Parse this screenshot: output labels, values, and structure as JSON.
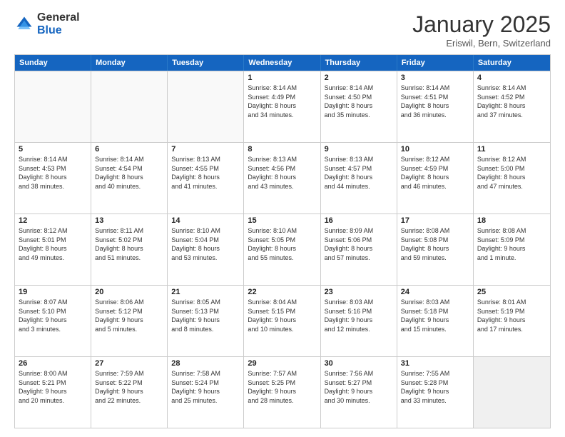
{
  "header": {
    "logo_general": "General",
    "logo_blue": "Blue",
    "month_title": "January 2025",
    "location": "Eriswil, Bern, Switzerland"
  },
  "weekdays": [
    "Sunday",
    "Monday",
    "Tuesday",
    "Wednesday",
    "Thursday",
    "Friday",
    "Saturday"
  ],
  "rows": [
    [
      {
        "day": "",
        "lines": []
      },
      {
        "day": "",
        "lines": []
      },
      {
        "day": "",
        "lines": []
      },
      {
        "day": "1",
        "lines": [
          "Sunrise: 8:14 AM",
          "Sunset: 4:49 PM",
          "Daylight: 8 hours",
          "and 34 minutes."
        ]
      },
      {
        "day": "2",
        "lines": [
          "Sunrise: 8:14 AM",
          "Sunset: 4:50 PM",
          "Daylight: 8 hours",
          "and 35 minutes."
        ]
      },
      {
        "day": "3",
        "lines": [
          "Sunrise: 8:14 AM",
          "Sunset: 4:51 PM",
          "Daylight: 8 hours",
          "and 36 minutes."
        ]
      },
      {
        "day": "4",
        "lines": [
          "Sunrise: 8:14 AM",
          "Sunset: 4:52 PM",
          "Daylight: 8 hours",
          "and 37 minutes."
        ]
      }
    ],
    [
      {
        "day": "5",
        "lines": [
          "Sunrise: 8:14 AM",
          "Sunset: 4:53 PM",
          "Daylight: 8 hours",
          "and 38 minutes."
        ]
      },
      {
        "day": "6",
        "lines": [
          "Sunrise: 8:14 AM",
          "Sunset: 4:54 PM",
          "Daylight: 8 hours",
          "and 40 minutes."
        ]
      },
      {
        "day": "7",
        "lines": [
          "Sunrise: 8:13 AM",
          "Sunset: 4:55 PM",
          "Daylight: 8 hours",
          "and 41 minutes."
        ]
      },
      {
        "day": "8",
        "lines": [
          "Sunrise: 8:13 AM",
          "Sunset: 4:56 PM",
          "Daylight: 8 hours",
          "and 43 minutes."
        ]
      },
      {
        "day": "9",
        "lines": [
          "Sunrise: 8:13 AM",
          "Sunset: 4:57 PM",
          "Daylight: 8 hours",
          "and 44 minutes."
        ]
      },
      {
        "day": "10",
        "lines": [
          "Sunrise: 8:12 AM",
          "Sunset: 4:59 PM",
          "Daylight: 8 hours",
          "and 46 minutes."
        ]
      },
      {
        "day": "11",
        "lines": [
          "Sunrise: 8:12 AM",
          "Sunset: 5:00 PM",
          "Daylight: 8 hours",
          "and 47 minutes."
        ]
      }
    ],
    [
      {
        "day": "12",
        "lines": [
          "Sunrise: 8:12 AM",
          "Sunset: 5:01 PM",
          "Daylight: 8 hours",
          "and 49 minutes."
        ]
      },
      {
        "day": "13",
        "lines": [
          "Sunrise: 8:11 AM",
          "Sunset: 5:02 PM",
          "Daylight: 8 hours",
          "and 51 minutes."
        ]
      },
      {
        "day": "14",
        "lines": [
          "Sunrise: 8:10 AM",
          "Sunset: 5:04 PM",
          "Daylight: 8 hours",
          "and 53 minutes."
        ]
      },
      {
        "day": "15",
        "lines": [
          "Sunrise: 8:10 AM",
          "Sunset: 5:05 PM",
          "Daylight: 8 hours",
          "and 55 minutes."
        ]
      },
      {
        "day": "16",
        "lines": [
          "Sunrise: 8:09 AM",
          "Sunset: 5:06 PM",
          "Daylight: 8 hours",
          "and 57 minutes."
        ]
      },
      {
        "day": "17",
        "lines": [
          "Sunrise: 8:08 AM",
          "Sunset: 5:08 PM",
          "Daylight: 8 hours",
          "and 59 minutes."
        ]
      },
      {
        "day": "18",
        "lines": [
          "Sunrise: 8:08 AM",
          "Sunset: 5:09 PM",
          "Daylight: 9 hours",
          "and 1 minute."
        ]
      }
    ],
    [
      {
        "day": "19",
        "lines": [
          "Sunrise: 8:07 AM",
          "Sunset: 5:10 PM",
          "Daylight: 9 hours",
          "and 3 minutes."
        ]
      },
      {
        "day": "20",
        "lines": [
          "Sunrise: 8:06 AM",
          "Sunset: 5:12 PM",
          "Daylight: 9 hours",
          "and 5 minutes."
        ]
      },
      {
        "day": "21",
        "lines": [
          "Sunrise: 8:05 AM",
          "Sunset: 5:13 PM",
          "Daylight: 9 hours",
          "and 8 minutes."
        ]
      },
      {
        "day": "22",
        "lines": [
          "Sunrise: 8:04 AM",
          "Sunset: 5:15 PM",
          "Daylight: 9 hours",
          "and 10 minutes."
        ]
      },
      {
        "day": "23",
        "lines": [
          "Sunrise: 8:03 AM",
          "Sunset: 5:16 PM",
          "Daylight: 9 hours",
          "and 12 minutes."
        ]
      },
      {
        "day": "24",
        "lines": [
          "Sunrise: 8:03 AM",
          "Sunset: 5:18 PM",
          "Daylight: 9 hours",
          "and 15 minutes."
        ]
      },
      {
        "day": "25",
        "lines": [
          "Sunrise: 8:01 AM",
          "Sunset: 5:19 PM",
          "Daylight: 9 hours",
          "and 17 minutes."
        ]
      }
    ],
    [
      {
        "day": "26",
        "lines": [
          "Sunrise: 8:00 AM",
          "Sunset: 5:21 PM",
          "Daylight: 9 hours",
          "and 20 minutes."
        ]
      },
      {
        "day": "27",
        "lines": [
          "Sunrise: 7:59 AM",
          "Sunset: 5:22 PM",
          "Daylight: 9 hours",
          "and 22 minutes."
        ]
      },
      {
        "day": "28",
        "lines": [
          "Sunrise: 7:58 AM",
          "Sunset: 5:24 PM",
          "Daylight: 9 hours",
          "and 25 minutes."
        ]
      },
      {
        "day": "29",
        "lines": [
          "Sunrise: 7:57 AM",
          "Sunset: 5:25 PM",
          "Daylight: 9 hours",
          "and 28 minutes."
        ]
      },
      {
        "day": "30",
        "lines": [
          "Sunrise: 7:56 AM",
          "Sunset: 5:27 PM",
          "Daylight: 9 hours",
          "and 30 minutes."
        ]
      },
      {
        "day": "31",
        "lines": [
          "Sunrise: 7:55 AM",
          "Sunset: 5:28 PM",
          "Daylight: 9 hours",
          "and 33 minutes."
        ]
      },
      {
        "day": "",
        "lines": []
      }
    ]
  ]
}
